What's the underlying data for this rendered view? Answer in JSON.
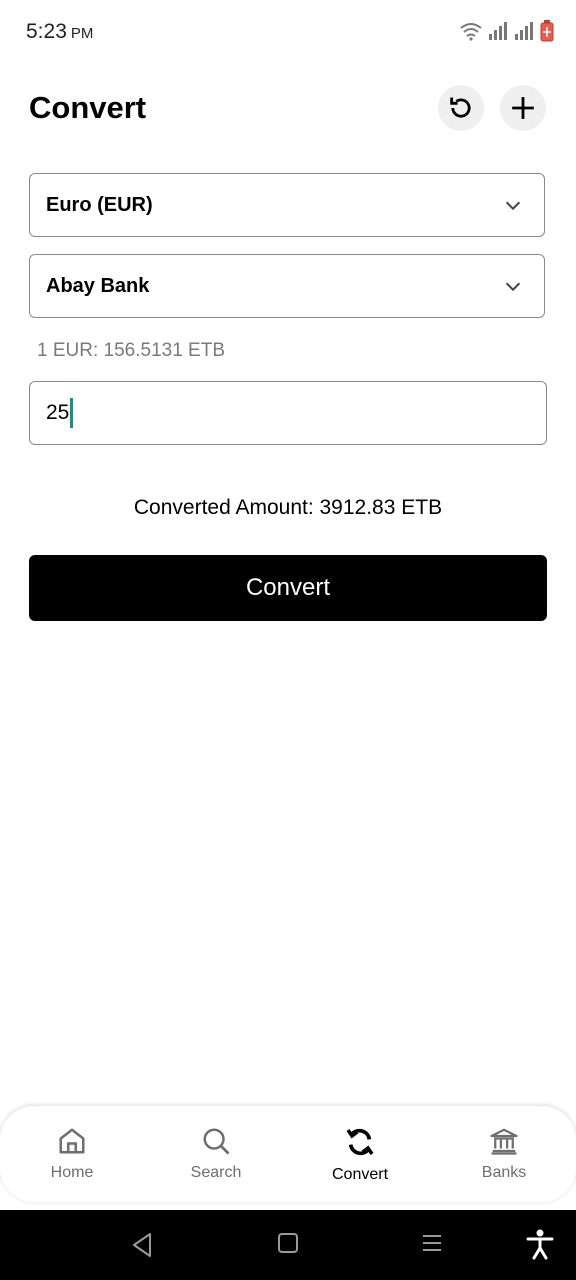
{
  "status_bar": {
    "time": "5:23",
    "ampm": "PM"
  },
  "header": {
    "title": "Convert",
    "reset_icon": "refresh-icon",
    "add_icon": "plus-icon"
  },
  "form": {
    "currency": {
      "selected": "Euro (EUR)"
    },
    "bank": {
      "selected": "Abay Bank"
    },
    "rate_text": "1 EUR: 156.5131 ETB",
    "amount_value": "25",
    "converted_text": "Converted Amount: 3912.83 ETB",
    "convert_label": "Convert"
  },
  "bottom_nav": {
    "items": [
      {
        "label": "Home",
        "icon": "home-icon",
        "active": false
      },
      {
        "label": "Search",
        "icon": "search-icon",
        "active": false
      },
      {
        "label": "Convert",
        "icon": "convert-icon",
        "active": true
      },
      {
        "label": "Banks",
        "icon": "bank-icon",
        "active": false
      }
    ]
  },
  "colors": {
    "accent": "#000000",
    "caret": "#1a8f85",
    "muted_text": "#7a7a7a",
    "battery": "#c0392b"
  }
}
